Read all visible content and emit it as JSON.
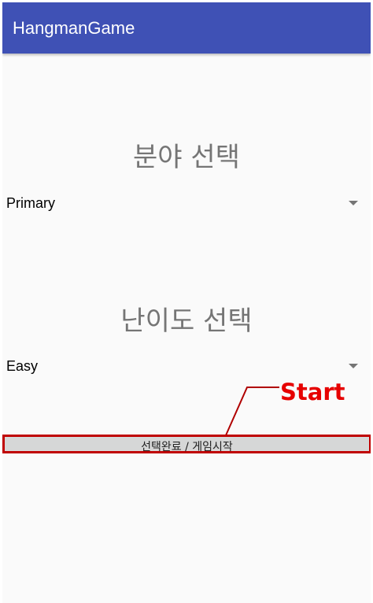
{
  "app": {
    "title": "HangmanGame"
  },
  "category": {
    "heading": "분야 선택",
    "selected": "Primary"
  },
  "difficulty": {
    "heading": "난이도 선택",
    "selected": "Easy"
  },
  "start_button": {
    "label": "선택완료 / 게임시작"
  },
  "annotation": {
    "label": "Start",
    "color": "#e60000"
  },
  "colors": {
    "appbar": "#3f51b5",
    "background": "#fafafa",
    "button": "#d6d7d7",
    "highlight_border": "#c00000"
  },
  "icons": {
    "spinner_arrow": "dropdown-arrow-icon"
  }
}
